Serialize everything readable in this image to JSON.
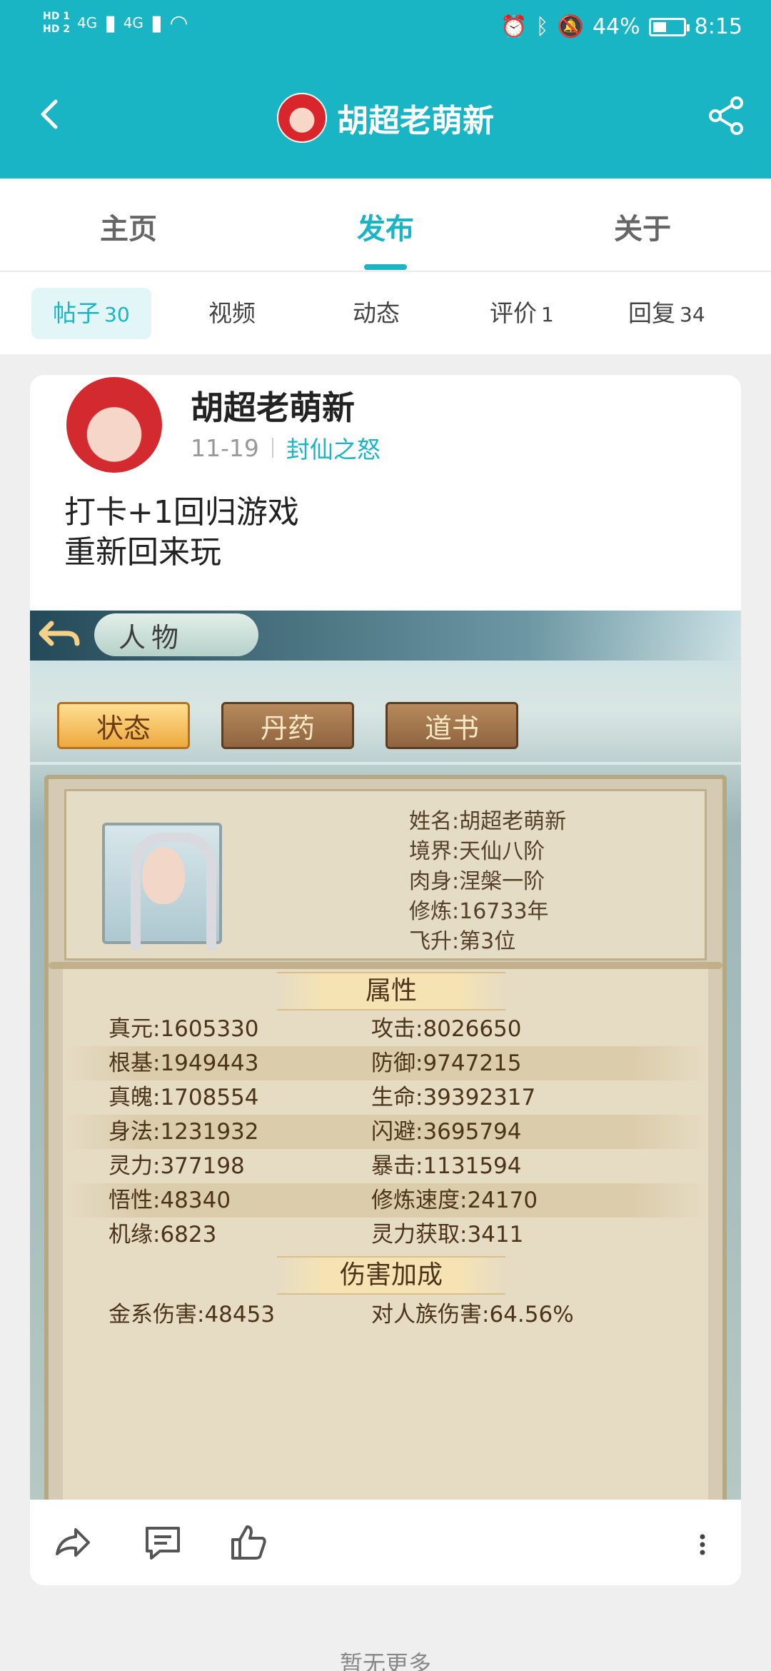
{
  "status_bar": {
    "hd1": "HD 1",
    "hd2": "HD 2",
    "sig1": "4G",
    "sig2": "4G",
    "battery": "44%",
    "time": "8:15"
  },
  "app_bar": {
    "title": "胡超老萌新",
    "accent": "#1ab5c4"
  },
  "main_tabs": [
    {
      "label": "主页"
    },
    {
      "label": "发布",
      "active": true
    },
    {
      "label": "关于"
    }
  ],
  "sub_tabs": [
    {
      "label": "帖子",
      "count": "30",
      "active": true
    },
    {
      "label": "视频",
      "count": ""
    },
    {
      "label": "动态",
      "count": ""
    },
    {
      "label": "评价",
      "count": "1"
    },
    {
      "label": "回复",
      "count": "34"
    }
  ],
  "post": {
    "author": "胡超老萌新",
    "date": "11-19",
    "game": "封仙之怒",
    "content_line1": "打卡+1回归游戏",
    "content_line2": "重新回来玩",
    "screenshot": {
      "header_title": "人物",
      "tabs": [
        "状态",
        "丹药",
        "道书"
      ],
      "profile": [
        "姓名:胡超老萌新",
        "境界:天仙八阶",
        "肉身:涅槃一阶",
        "修炼:16733年",
        "飞升:第3位"
      ],
      "section_attr": "属性",
      "stats": [
        [
          "真元:1605330",
          "攻击:8026650"
        ],
        [
          "根基:1949443",
          "防御:9747215"
        ],
        [
          "真魄:1708554",
          "生命:39392317"
        ],
        [
          "身法:1231932",
          "闪避:3695794"
        ],
        [
          "灵力:377198",
          "暴击:1131594"
        ],
        [
          "悟性:48340",
          "修炼速度:24170"
        ],
        [
          "机缘:6823",
          "灵力获取:3411"
        ]
      ],
      "section_damage": "伤害加成",
      "damage": [
        [
          "金系伤害:48453",
          "对人族伤害:64.56%"
        ]
      ]
    }
  },
  "footer": "暂无更多"
}
